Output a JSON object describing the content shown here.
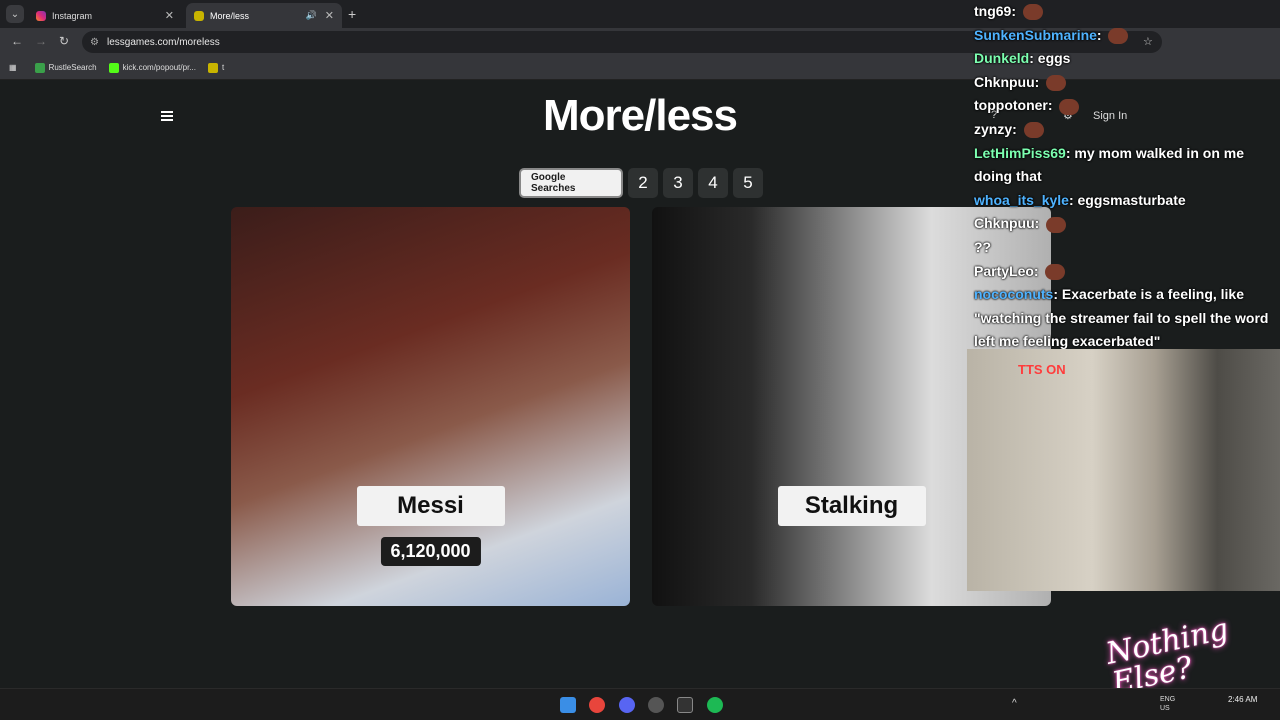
{
  "browser": {
    "tabs": [
      {
        "title": "Instagram",
        "active": false
      },
      {
        "title": "More/less",
        "active": true
      }
    ],
    "url": "lessgames.com/moreless",
    "bookmarks": [
      {
        "label": "RustleSearch"
      },
      {
        "label": "kick.com/popout/pr..."
      },
      {
        "label": "t"
      }
    ]
  },
  "page": {
    "title": "More/less",
    "sign_in": "Sign In",
    "mode_tabs": [
      "Google Searches",
      "2",
      "3",
      "4",
      "5"
    ],
    "cards": [
      {
        "label": "Messi",
        "value": "6,120,000"
      },
      {
        "label": "Stalking"
      }
    ]
  },
  "chat": {
    "messages": [
      {
        "user": "tng69",
        "color": "#ffffff",
        "text": ""
      },
      {
        "user": "SunkenSubmarine",
        "color": "#4fb3ff",
        "text": ""
      },
      {
        "user": "Dunkeld",
        "color": "#7cffb0",
        "text": "eggs"
      },
      {
        "user": "Chknpuu",
        "color": "#ffffff",
        "text": ""
      },
      {
        "user": "toppotoner",
        "color": "#ffffff",
        "text": ""
      },
      {
        "user": "zynzy",
        "color": "#ffffff",
        "text": ""
      },
      {
        "user": "LetHimPiss69",
        "color": "#7cffb0",
        "text": "my mom walked in on me doing that"
      },
      {
        "user": "whoa_its_kyle",
        "color": "#4fb3ff",
        "text": "eggsmasturbate"
      },
      {
        "user": "Chknpuu",
        "color": "#ffffff",
        "text": ""
      },
      {
        "user": "",
        "color": "#ffffff",
        "text": "??"
      },
      {
        "user": "PartyLeo",
        "color": "#ffffff",
        "text": ""
      },
      {
        "user": "nococonuts",
        "color": "#4fb3ff",
        "text": "Exacerbate is a feeling, like \"watching the streamer fail to spell the word left me feeling exacerbated\""
      }
    ]
  },
  "overlay": {
    "tts": "TTS ON",
    "logo": "Nothing Else?"
  },
  "taskbar": {
    "time": "2:46 AM",
    "lang": "ENG US"
  },
  "colors": {
    "page_bg": "#1a1d1d",
    "tab_active": "#f1f1f1",
    "tab_inactive": "#2e3131"
  }
}
